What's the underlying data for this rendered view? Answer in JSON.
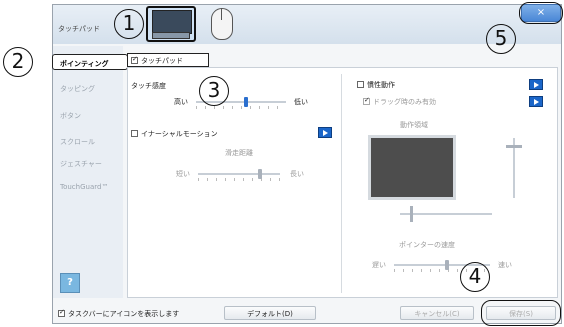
{
  "window": {
    "title": "タッチパッド"
  },
  "callouts": [
    "1",
    "2",
    "3",
    "4",
    "5"
  ],
  "sidebar": {
    "items": [
      {
        "label": "ポインティング"
      },
      {
        "label": "タッピング"
      },
      {
        "label": "ボタン"
      },
      {
        "label": "スクロール"
      },
      {
        "label": "ジェスチャー"
      },
      {
        "label": "TouchGuard™"
      }
    ],
    "help_label": "?"
  },
  "tab": {
    "label": "タッチパッド"
  },
  "left_panel": {
    "sensitivity_label": "タッチ感度",
    "sens_high": "高い",
    "sens_low": "低い",
    "sensitivity_level": 0.55,
    "inertial_label": "イナーシャルモーション",
    "distance_label": "滑走距離",
    "dist_short": "短い",
    "dist_long": "長い",
    "distance_level": 0.75
  },
  "right_panel": {
    "inertia_label": "慣性動作",
    "drag_only_label": "ドラッグ時のみ有効",
    "operation_area_label": "動作領域",
    "pointer_speed_label": "ポインターの速度",
    "speed_slow": "遅い",
    "speed_fast": "速い",
    "pointer_speed_level": 0.55
  },
  "footer": {
    "taskbar_label": "タスクバーにアイコンを表示します",
    "default_button": "デフォルト(D)",
    "cancel_button": "キャンセル(C)",
    "save_button": "保存(S)"
  },
  "close_glyph": "×",
  "colors": {
    "accent": "#2b6fce",
    "title_bg": "#dde6ef"
  }
}
